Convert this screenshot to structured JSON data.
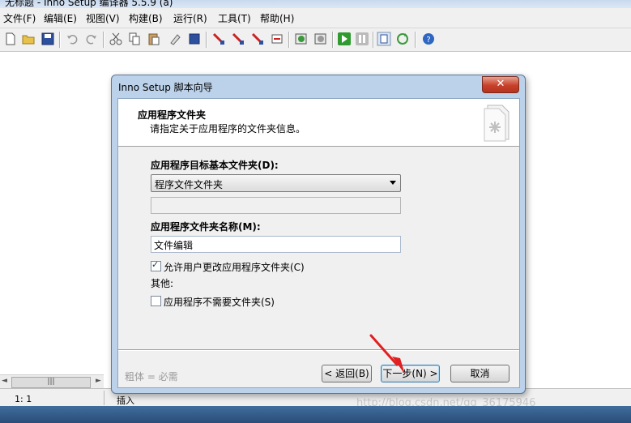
{
  "window": {
    "title": "无标题 - Inno Setup 编译器 5.5.9 (a)"
  },
  "menu": [
    "文件(F)",
    "编辑(E)",
    "视图(V)",
    "构建(B)",
    "运行(R)",
    "工具(T)",
    "帮助(H)"
  ],
  "toolbar": {
    "icons": [
      "new-file-icon",
      "open-folder-icon",
      "save-icon",
      "undo-icon",
      "redo-icon",
      "cut-icon",
      "copy-icon",
      "paste-icon",
      "clear-icon",
      "select-all-icon",
      "compile-icon",
      "compile-stop-icon",
      "compile-wizard-icon",
      "find-icon",
      "target-icon",
      "target-alt-icon",
      "run-icon",
      "pause-icon",
      "step-icon",
      "refresh-icon",
      "help-icon"
    ]
  },
  "dialog": {
    "title": "Inno Setup 脚本向导",
    "close_label": "✕",
    "header_title": "应用程序文件夹",
    "header_subtitle": "请指定关于应用程序的文件夹信息。",
    "base_folder_label": "应用程序目标基本文件夹(D):",
    "base_folder_value": "程序文件文件夹",
    "custom_folder_value": "",
    "folder_name_label": "应用程序文件夹名称(M):",
    "folder_name_value": "文件编辑",
    "allow_change_label": "允许用户更改应用程序文件夹(C)",
    "allow_change_checked": true,
    "other_label": "其他:",
    "no_folder_label": "应用程序不需要文件夹(S)",
    "no_folder_checked": false,
    "required_note": "粗体 = 必需",
    "back_button": "< 返回(B)",
    "next_button": "下一步(N) >",
    "cancel_button": "取消"
  },
  "statusbar": {
    "position": "1:   1",
    "mode": "插入"
  },
  "watermark": "http://blog.csdn.net/qq_36175946",
  "colors": {
    "accent": "#3c7fb1",
    "arrow": "#e02020",
    "taskbar": "#2b4c78"
  }
}
